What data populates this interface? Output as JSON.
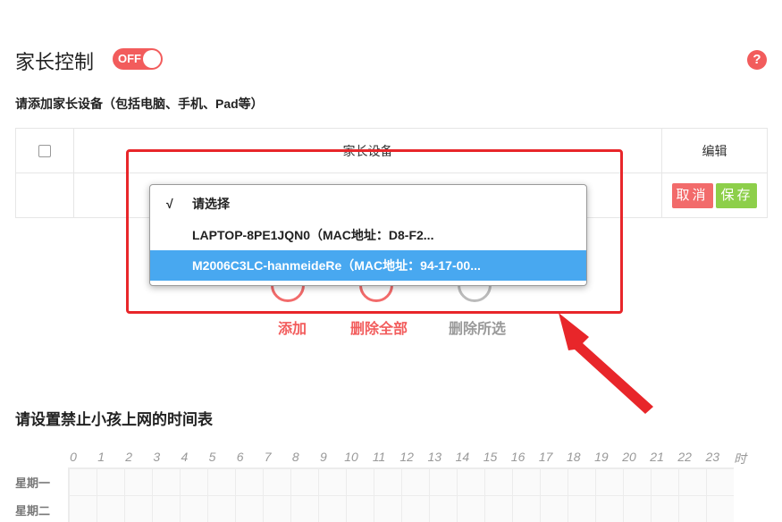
{
  "header": {
    "title": "家长控制",
    "toggle_label": "OFF",
    "help_label": "?"
  },
  "device_section": {
    "subtitle": "请添加家长设备（包括电脑、手机、Pad等）",
    "col_device": "家长设备",
    "col_edit": "编辑",
    "cancel_label": "取消",
    "save_label": "保存"
  },
  "dropdown": {
    "options": [
      {
        "check": "√",
        "label": "请选择"
      },
      {
        "check": "",
        "label": "LAPTOP-8PE1JQN0（MAC地址：D8-F2..."
      },
      {
        "check": "",
        "label": "M2006C3LC-hanmeideRe（MAC地址：94-17-00..."
      }
    ]
  },
  "actions": {
    "add": "添加",
    "delete_all": "删除全部",
    "delete_selected": "删除所选"
  },
  "schedule": {
    "title": "请设置禁止小孩上网的时间表",
    "hours": [
      "0",
      "1",
      "2",
      "3",
      "4",
      "5",
      "6",
      "7",
      "8",
      "9",
      "10",
      "11",
      "12",
      "13",
      "14",
      "15",
      "16",
      "17",
      "18",
      "19",
      "20",
      "21",
      "22",
      "23"
    ],
    "hour_unit": "时",
    "days": [
      "星期一",
      "星期二"
    ]
  },
  "colors": {
    "accent_red": "#f25c5c",
    "save_green": "#8dcf4a",
    "selected_blue": "#48a8f0",
    "annotation_red": "#e8262a"
  }
}
